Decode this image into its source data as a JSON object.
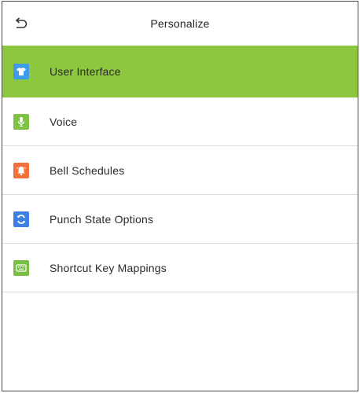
{
  "header": {
    "title": "Personalize",
    "back_icon": "back-arrow-icon"
  },
  "menu": {
    "selected_index": 0,
    "items": [
      {
        "label": "User Interface",
        "icon": "tshirt-icon",
        "icon_color": "#3d9be9"
      },
      {
        "label": "Voice",
        "icon": "microphone-icon",
        "icon_color": "#7dc242"
      },
      {
        "label": "Bell Schedules",
        "icon": "bell-icon",
        "icon_color": "#f2703a"
      },
      {
        "label": "Punch State Options",
        "icon": "refresh-icon",
        "icon_color": "#3f7fe4"
      },
      {
        "label": "Shortcut Key Mappings",
        "icon": "keyboard-icon",
        "icon_color": "#78bf44"
      }
    ]
  },
  "colors": {
    "selected_background": "#8dc63f",
    "divider": "#dcdcdc"
  }
}
